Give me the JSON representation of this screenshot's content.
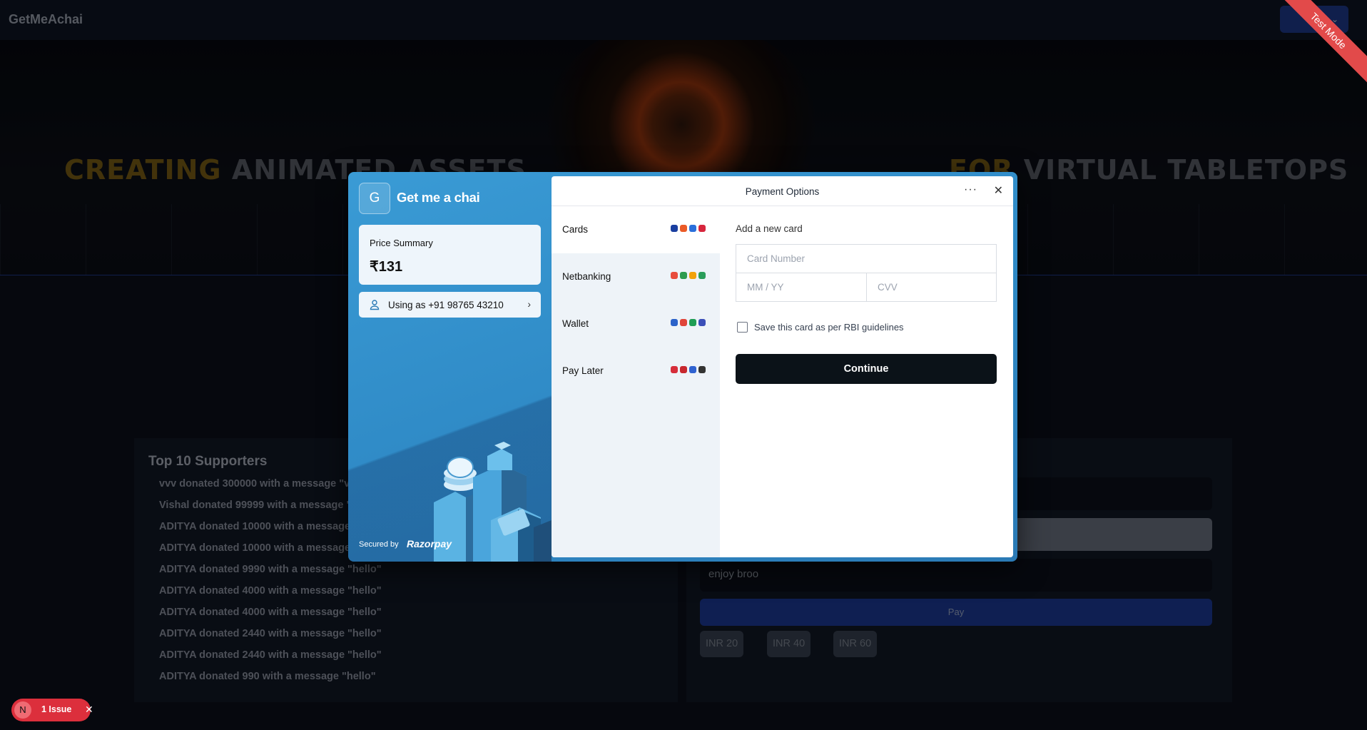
{
  "navbar": {
    "brand": "GetMeAchai",
    "menu_chevron": "⌄"
  },
  "banner": {
    "left_accent": "CREATING",
    "left_rest": " ANIMATED ASSETS",
    "right_accent": "FOR",
    "right_rest": " VIRTUAL TABLETOPS"
  },
  "supporters": {
    "title": "Top 10 Supporters",
    "items": [
      "vvv donated 300000 with a message \"v",
      "Vishal donated 99999 with a message \"",
      "ADITYA donated 10000 with a message",
      "ADITYA donated 10000 with a message",
      "ADITYA donated 9990 with a message \"hello\"",
      "ADITYA donated 4000 with a message \"hello\"",
      "ADITYA donated 4000 with a message \"hello\"",
      "ADITYA donated 2440 with a message \"hello\"",
      "ADITYA donated 2440 with a message \"hello\"",
      "ADITYA donated 990 with a message \"hello\""
    ]
  },
  "payment_panel": {
    "message_value": "enjoy broo",
    "pay_label": "Pay",
    "amount_chips": [
      "INR 20",
      "INR 40",
      "INR 60"
    ]
  },
  "test_mode": "Test Mode",
  "issue_badge": {
    "initial": "N",
    "label": "1 Issue",
    "close": "✕"
  },
  "checkout": {
    "merchant_initial": "G",
    "merchant_name": "Get me a chai",
    "price_summary_label": "Price Summary",
    "price_value": "₹131",
    "user_text": "Using as +91 98765 43210",
    "secured_by": "Secured by",
    "provider": "Razorpay",
    "title": "Payment Options",
    "more_icon": "···",
    "close_icon": "✕",
    "methods": [
      {
        "label": "Cards",
        "icon_colors": [
          "#1a3fa0",
          "#eb5b27",
          "#2a6fdb",
          "#d7263d"
        ]
      },
      {
        "label": "Netbanking",
        "icon_colors": [
          "#e84c3d",
          "#2d9b4e",
          "#f2a20a",
          "#2a9d5a"
        ]
      },
      {
        "label": "Wallet",
        "icon_colors": [
          "#2b62c9",
          "#e0453a",
          "#1f9d55",
          "#3b4fb8"
        ]
      },
      {
        "label": "Pay Later",
        "icon_colors": [
          "#d62d3a",
          "#c7272e",
          "#2f62d0",
          "#333333"
        ]
      }
    ],
    "add_card_label": "Add a new card",
    "card_number_placeholder": "Card Number",
    "expiry_placeholder": "MM / YY",
    "cvv_placeholder": "CVV",
    "save_card_label": "Save this card as per RBI guidelines",
    "continue_label": "Continue"
  },
  "colors": {
    "checkout_blue": "#3a9bd5",
    "accent_gold": "#d4a015",
    "continue_button": "#0b1218",
    "pay_button": "#1d3a96",
    "test_ribbon": "#e24a4a"
  }
}
